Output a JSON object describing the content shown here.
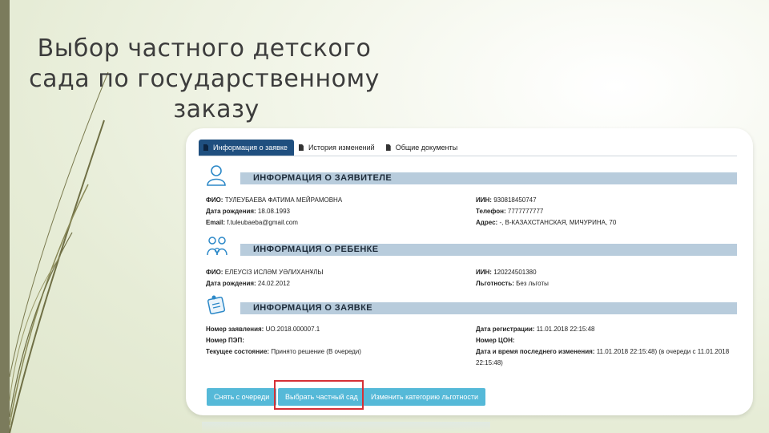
{
  "slide": {
    "title_line1": "Выбор частного детского",
    "title_line2": "сада по государственному",
    "title_line3": "заказу"
  },
  "tabs": [
    {
      "label": "Информация о заявке",
      "active": true
    },
    {
      "label": "История изменений",
      "active": false
    },
    {
      "label": "Общие документы",
      "active": false
    }
  ],
  "applicant": {
    "header": "ИНФОРМАЦИЯ О ЗАЯВИТЕЛЕ",
    "fio_label": "ФИО:",
    "fio": "ТУЛЕУБАЕВА ФАТИМА МЕЙРАМОВНА",
    "birth_label": "Дата рождения:",
    "birth": "18.08.1993",
    "email_label": "Email:",
    "email": "f.tuleubaeba@gmail.com",
    "iin_label": "ИИН:",
    "iin": "930818450747",
    "phone_label": "Телефон:",
    "phone": "7777777777",
    "address_label": "Адрес:",
    "address": "-, В-КАЗАХСТАНСКАЯ, МИЧУРИНА, 70"
  },
  "child": {
    "header": "ИНФОРМАЦИЯ О РЕБЕНКЕ",
    "fio_label": "ФИО:",
    "fio": "ЕЛЕУСІЗ ИСЛӘМ УӘЛИХАНҰЛЫ",
    "birth_label": "Дата рождения:",
    "birth": "24.02.2012",
    "iin_label": "ИИН:",
    "iin": "120224501380",
    "benefits_label": "Льготность:",
    "benefits": "Без льготы"
  },
  "application": {
    "header": "ИНФОРМАЦИЯ О ЗАЯВКЕ",
    "number_label": "Номер заявления:",
    "number": "UO.2018.000007.1",
    "pep_label": "Номер ПЭП:",
    "pep": "",
    "state_label": "Текущее состояние:",
    "state": "Принято решение (В очереди)",
    "reg_date_label": "Дата регистрации:",
    "reg_date": "11.01.2018 22:15:48",
    "con_label": "Номер ЦОН:",
    "con": "",
    "last_change_label": "Дата и время последнего изменения:",
    "last_change": "11.01.2018 22:15:48) (в очереди с 11.01.2018 22:15:48)"
  },
  "buttons": {
    "remove_queue": "Снять с очереди",
    "choose_private": "Выбрать частный сад",
    "change_category": "Изменить категорию льготности"
  },
  "colors": {
    "tab_active": "#1f4f7f",
    "section_bar": "#b8ccdc",
    "button": "#55b9d8",
    "highlight": "#d63036",
    "icon_blue": "#2d89c8"
  }
}
